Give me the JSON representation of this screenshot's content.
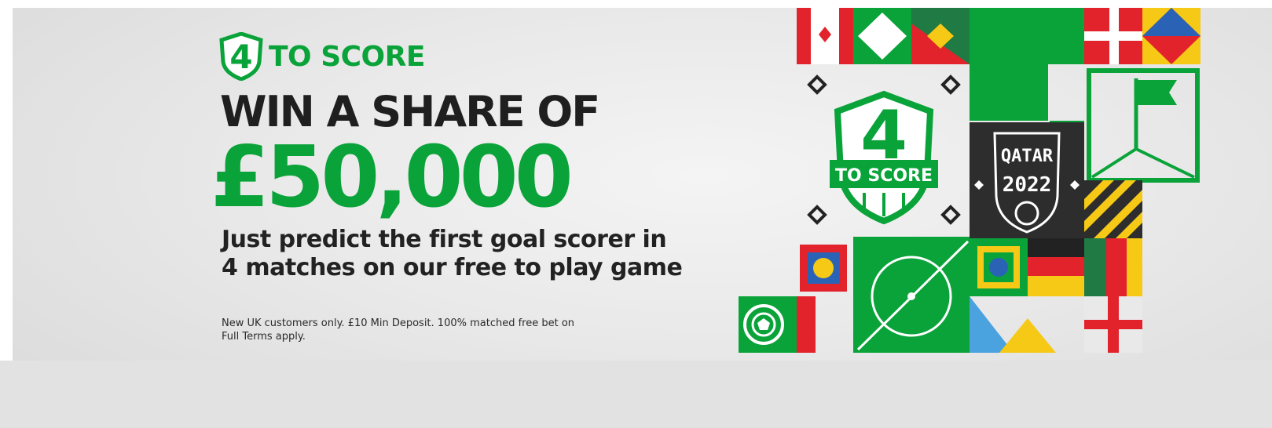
{
  "promo": {
    "logo_number": "4",
    "logo_text": "TO SCORE",
    "headline": "WIN A SHARE OF",
    "amount": "£50,000",
    "subline_1": "Just predict the first goal scorer in",
    "subline_2": "4 matches on our free to play game",
    "terms_1": "New UK customers only. £10 Min Deposit. 100% matched free bet on",
    "terms_2": "Full Terms apply."
  },
  "artwork": {
    "badge_number": "4",
    "badge_text": "TO SCORE",
    "qatar_label": "QATAR",
    "year_label": "2022"
  },
  "colors": {
    "brand_green": "#0aa33a",
    "dark_text": "#1f1f1f",
    "red": "#e2232c",
    "yellow": "#f6c916",
    "blue": "#2a63b5",
    "dark_panel": "#2d2d2d"
  }
}
